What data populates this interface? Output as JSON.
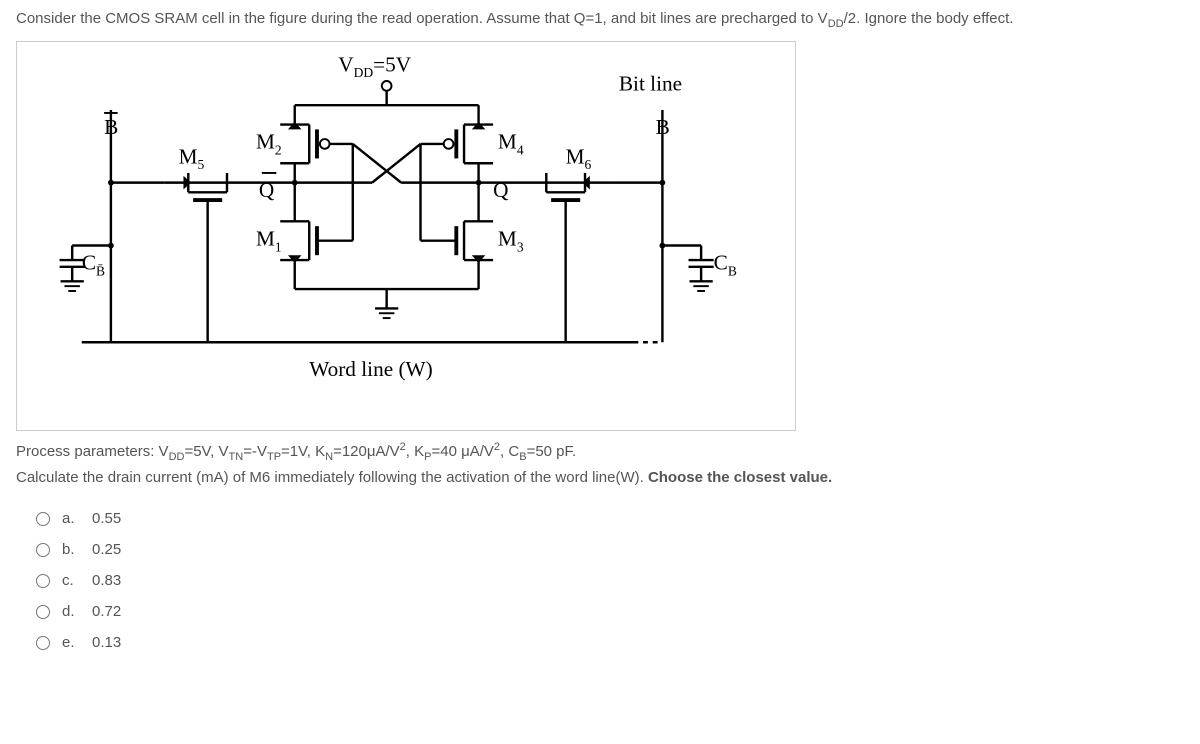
{
  "question": {
    "intro": "Consider the CMOS SRAM cell in the figure during the read operation. Assume that Q=1, and bit lines are precharged to V",
    "intro_sub1": "DD",
    "intro_cont": "/2. Ignore the body effect."
  },
  "figure": {
    "vdd_label": "V",
    "vdd_sub": "DD",
    "vdd_value": "=5V",
    "bitline_label": "Bit line",
    "b_label": "B",
    "b_bar_label": "B",
    "q_label": "Q",
    "q_bar_label": "Q",
    "m1": "M",
    "m1_sub": "1",
    "m2": "M",
    "m2_sub": "2",
    "m3": "M",
    "m3_sub": "3",
    "m4": "M",
    "m4_sub": "4",
    "m5": "M",
    "m5_sub": "5",
    "m6": "M",
    "m6_sub": "6",
    "cb_bar": "C",
    "cb_bar_sub": "B̄",
    "cb": "C",
    "cb_sub": "B",
    "wordline": "Word line (W)"
  },
  "parameters": {
    "line1_part1": "Process parameters: V",
    "line1_sub1": "DD",
    "line1_part2": "=5V, V",
    "line1_sub2": "TN",
    "line1_part3": "=-V",
    "line1_sub3": "TP",
    "line1_part4": "=1V, K",
    "line1_sub4": "N",
    "line1_part5": "=120μA/V",
    "line1_sup1": "2",
    "line1_part6": ", K",
    "line1_sub5": "P",
    "line1_part7": "=40 μA/V",
    "line1_sup2": "2",
    "line1_part8": ", C",
    "line1_sub6": "B",
    "line1_part9": "=50 pF.",
    "line2_part1": "Calculate the drain current (mA) of M6 immediately following the activation of the word line(W). ",
    "line2_bold": "Choose the closest value."
  },
  "options": [
    {
      "letter": "a.",
      "value": "0.55"
    },
    {
      "letter": "b.",
      "value": "0.25"
    },
    {
      "letter": "c.",
      "value": "0.83"
    },
    {
      "letter": "d.",
      "value": "0.72"
    },
    {
      "letter": "e.",
      "value": "0.13"
    }
  ]
}
